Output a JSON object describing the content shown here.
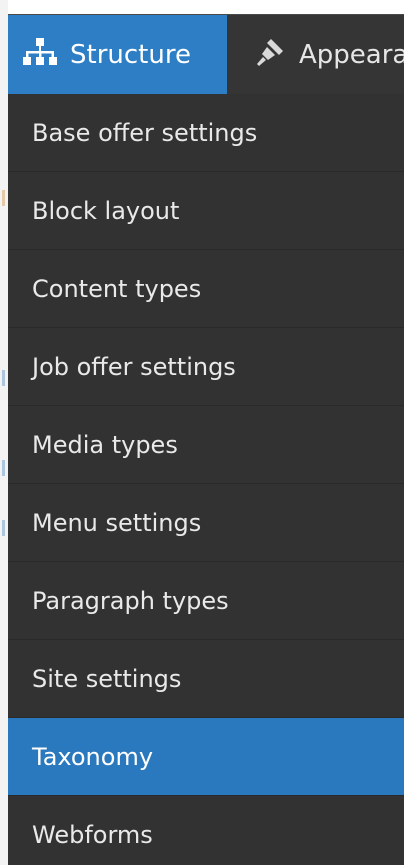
{
  "toolbar": {
    "structure_label": "Structure",
    "appearance_label": "Appearar",
    "structure_icon": "sitemap-icon",
    "appearance_icon": "paintbrush-icon",
    "accent_color": "#2d7ec4"
  },
  "menu": {
    "items": [
      {
        "label": "Base offer settings"
      },
      {
        "label": "Block layout"
      },
      {
        "label": "Content types"
      },
      {
        "label": "Job offer settings"
      },
      {
        "label": "Media types"
      },
      {
        "label": "Menu settings"
      },
      {
        "label": "Paragraph types"
      },
      {
        "label": "Site settings"
      },
      {
        "label": "Taxonomy",
        "active": true
      },
      {
        "label": "Webforms"
      }
    ]
  }
}
